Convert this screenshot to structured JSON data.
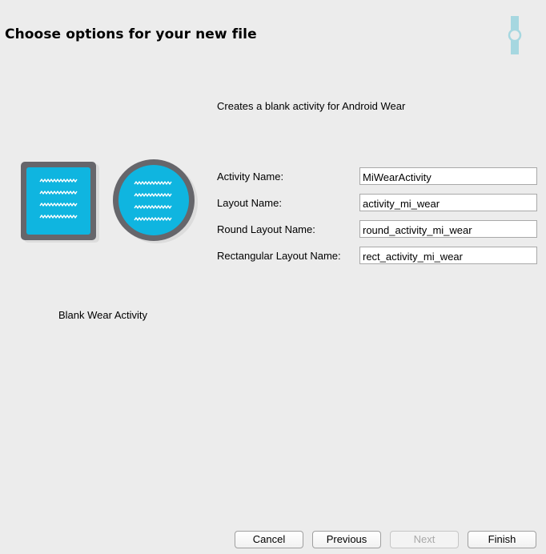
{
  "header": {
    "title": "Choose options for your new file",
    "logo_icon": "android-wear-watch-icon",
    "logo_color": "#a6d7e0"
  },
  "template": {
    "description": "Creates a blank activity for Android Wear",
    "name": "Blank Wear Activity",
    "preview_icon": "wear-square-and-round-watch-icon",
    "accent_color": "#0fb5e0",
    "frame_color": "#66666b"
  },
  "form": {
    "activity_name": {
      "label": "Activity Name:",
      "value": "MiWearActivity"
    },
    "layout_name": {
      "label": "Layout Name:",
      "value": "activity_mi_wear"
    },
    "round_layout_name": {
      "label": "Round Layout Name:",
      "value": "round_activity_mi_wear"
    },
    "rect_layout_name": {
      "label": "Rectangular Layout Name:",
      "value": "rect_activity_mi_wear"
    }
  },
  "buttons": {
    "cancel": "Cancel",
    "previous": "Previous",
    "next": "Next",
    "finish": "Finish"
  }
}
